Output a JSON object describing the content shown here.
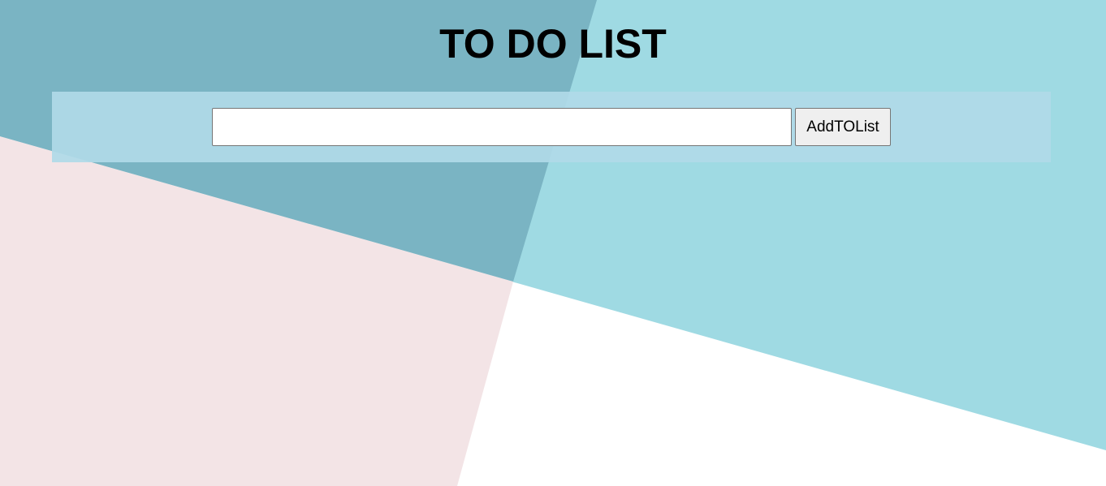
{
  "header": {
    "title": "TO DO LIST"
  },
  "add_form": {
    "input_value": "",
    "input_placeholder": "",
    "button_label": "AddTOList"
  },
  "colors": {
    "page_background": "#ffffff",
    "teal_dark": "#7ab4c3",
    "teal_light": "#9fdae3",
    "pink": "#f3e4e6",
    "bar_background": "#b0dae8",
    "button_background": "#efefef"
  }
}
